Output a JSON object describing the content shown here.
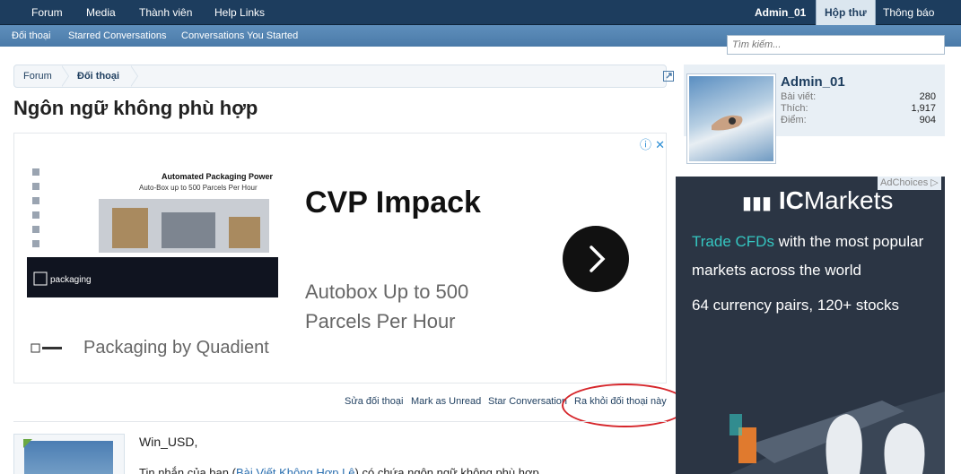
{
  "topnav": {
    "items": [
      "Forum",
      "Media",
      "Thành viên",
      "Help Links"
    ],
    "user": "Admin_01",
    "inbox": "Hộp thư",
    "alerts": "Thông báo"
  },
  "subnav": {
    "items": [
      "Đối thoại",
      "Starred Conversations",
      "Conversations You Started"
    ]
  },
  "search": {
    "placeholder": "Tìm kiếm..."
  },
  "breadcrumb": {
    "items": [
      "Forum",
      "Đối thoại"
    ]
  },
  "page": {
    "title": "Ngôn ngữ không phù hợp"
  },
  "ad": {
    "headline": "CVP Impack",
    "subline": "Autobox Up to 500 Parcels Per Hour",
    "brand": "Packaging by Quadient",
    "image_title": "Automated Packaging Power",
    "image_subtitle": "Auto-Box up to 500 Parcels Per Hour",
    "image_logo": "packaging"
  },
  "actions": {
    "edit": "Sửa đối thoại",
    "unread": "Mark as Unread",
    "star": "Star Conversation",
    "leave": "Ra khỏi đối thoại này"
  },
  "message": {
    "greeting": "Win_USD,",
    "line_start": "Tin nhắn của bạn (",
    "line_link": "Bài Viết Không Hợp Lệ",
    "line_end": ") có chứa ngôn ngữ không phù hợp"
  },
  "profile": {
    "name": "Admin_01",
    "stats": [
      {
        "label": "Bài viết:",
        "value": "280"
      },
      {
        "label": "Thích:",
        "value": "1,917"
      },
      {
        "label": "Điểm:",
        "value": "904"
      }
    ]
  },
  "side_ad": {
    "adchoices": "AdChoices",
    "logo_ic": "IC",
    "logo_rest": "Markets",
    "line1_hl": "Trade CFDs",
    "line1_rest": " with the most popular",
    "line2": "markets across the world",
    "line3": "64 currency pairs, 120+ stocks"
  },
  "colors": {
    "nav_bg": "#1d3d5e",
    "subnav_bg": "#4a7aa8",
    "link": "#1d3d5e",
    "highlight": "#d6262b",
    "ad_bg": "#2b3544",
    "ad_accent": "#35c6c1"
  }
}
